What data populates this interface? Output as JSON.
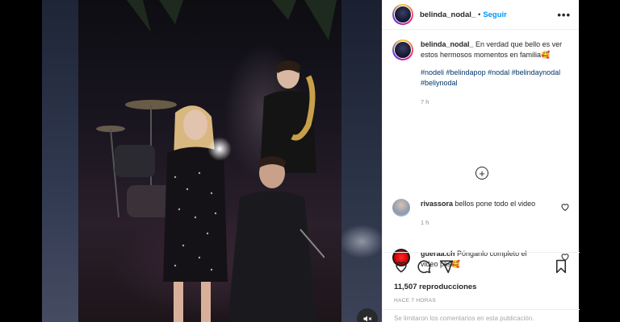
{
  "post": {
    "username": "belinda_nodal_",
    "separator": "•",
    "follow_label": "Seguir",
    "more_label": "•••"
  },
  "caption": {
    "username": "belinda_nodal_",
    "text": "En verdad que bello es ver estos hermosos momentos en familia🥰",
    "hashtags": "#nodeli #belindapop #nodal #belindaynodal #beliynodal",
    "time": "7 h"
  },
  "load_more_label": "+",
  "comments": [
    {
      "username": "rivassora",
      "text": "bellos pone todo el video",
      "time": "1 h"
    },
    {
      "username": "gueraa.ch",
      "text": "Pónganlo completo el video plis🥰",
      "time": ""
    }
  ],
  "actions": {
    "views": "11,507 reproducciones",
    "posted_ago": "HACE 7 HORAS"
  },
  "footer": {
    "comments_limited": "Se limitaron los comentarios en esta publicación."
  },
  "colors": {
    "accent": "#0095f6",
    "hashtag": "#00376b",
    "muted": "#8e8e8e"
  },
  "icons": [
    "muted-speaker-icon",
    "ellipsis-icon",
    "plus-circle-icon",
    "heart-icon",
    "comment-icon",
    "share-icon",
    "bookmark-icon"
  ]
}
